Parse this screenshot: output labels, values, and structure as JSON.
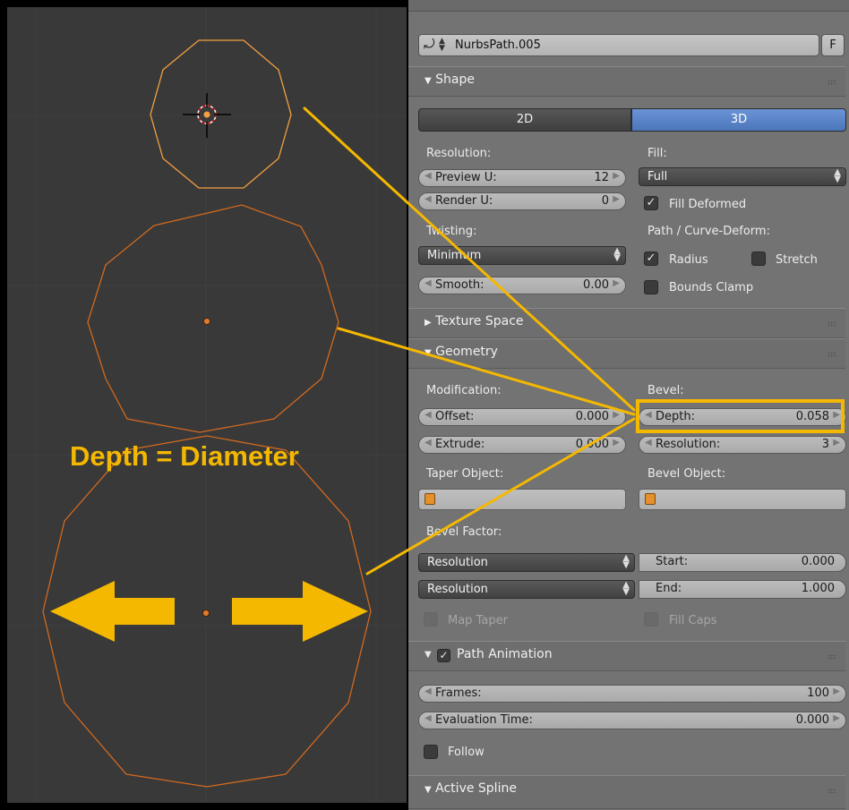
{
  "datablock": {
    "name": "NurbsPath.005",
    "fake_user": "F"
  },
  "shape": {
    "header": "Shape",
    "mode_2d": "2D",
    "mode_3d": "3D",
    "resolution_label": "Resolution:",
    "preview_u": {
      "label": "Preview U:",
      "value": "12"
    },
    "render_u": {
      "label": "Render U:",
      "value": "0"
    },
    "fill_label": "Fill:",
    "fill_value": "Full",
    "fill_deformed": "Fill Deformed",
    "twisting_label": "Twisting:",
    "twisting_value": "Minimum",
    "smooth": {
      "label": "Smooth:",
      "value": "0.00"
    },
    "path_deform_label": "Path / Curve-Deform:",
    "radius": "Radius",
    "stretch": "Stretch",
    "bounds_clamp": "Bounds Clamp"
  },
  "texture_space": {
    "header": "Texture Space"
  },
  "geometry": {
    "header": "Geometry",
    "modification_label": "Modification:",
    "offset": {
      "label": "Offset:",
      "value": "0.000"
    },
    "extrude": {
      "label": "Extrude:",
      "value": "0.000"
    },
    "bevel_label": "Bevel:",
    "depth": {
      "label": "Depth:",
      "value": "0.058"
    },
    "bevel_resolution": {
      "label": "Resolution:",
      "value": "3"
    },
    "taper_label": "Taper Object:",
    "bevel_object_label": "Bevel Object:",
    "bevel_factor_label": "Bevel Factor:",
    "mapping_start": "Resolution",
    "mapping_end": "Resolution",
    "start": {
      "label": "Start:",
      "value": "0.000"
    },
    "end": {
      "label": "End:",
      "value": "1.000"
    },
    "map_taper": "Map Taper",
    "fill_caps": "Fill Caps"
  },
  "path_animation": {
    "header": "Path Animation",
    "frames": {
      "label": "Frames:",
      "value": "100"
    },
    "eval_time": {
      "label": "Evaluation Time:",
      "value": "0.000"
    },
    "follow": "Follow"
  },
  "active_spline": {
    "header": "Active Spline"
  },
  "annotation": {
    "text": "Depth = Diameter"
  },
  "colors": {
    "accent": "#f5b800",
    "selected_curve": "#f2a040",
    "curve": "#d2691e",
    "active_blue": "#5680c2",
    "panel_bg": "#737373",
    "viewport_bg": "#393939"
  },
  "icons": [
    "curve-datablock-icon",
    "checkmark-icon",
    "cube-icon",
    "grip-icon",
    "triangle-expand-icon"
  ]
}
